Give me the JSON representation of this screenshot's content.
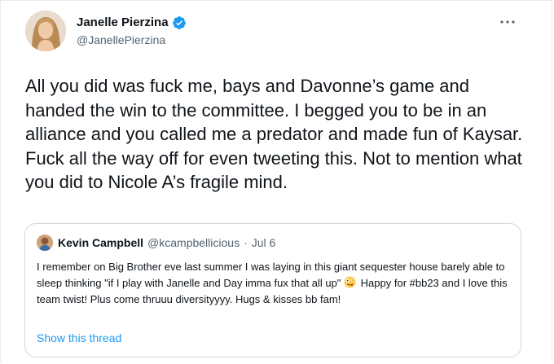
{
  "author": {
    "display_name": "Janelle Pierzina",
    "handle": "@JanellePierzina",
    "verified_icon": "verified-badge-icon"
  },
  "more_icon": "more-options-icon",
  "tweet": {
    "text": "All you did was fuck me, bays and Davonne’s game and handed the win to the committee. I begged you to be in an alliance and you called me a predator and made fun of Kaysar. Fuck all the way off for even tweeting this. Not to mention what you did to Nicole A’s fragile mind."
  },
  "quoted_tweet": {
    "display_name": "Kevin Campbell",
    "handle": "@kcampbellicious",
    "separator": "·",
    "date": "Jul 6",
    "text_before_emoji": "I remember on Big Brother eve last summer I was laying in this giant sequester house barely able to sleep thinking \"if I play with Janelle and Day imma fux that all up\" ",
    "emoji_icon": "zany-face-emoji-icon",
    "text_after_emoji": " Happy for #bb23 and I love this team twist! Plus come thruuu diversityyyy. Hugs & kisses bb fam!",
    "show_thread_label": "Show this thread"
  },
  "colors": {
    "link_blue": "#1d9bf0",
    "secondary_text": "#536471",
    "border": "#cfd9de",
    "verified_blue": "#1d9bf0"
  }
}
